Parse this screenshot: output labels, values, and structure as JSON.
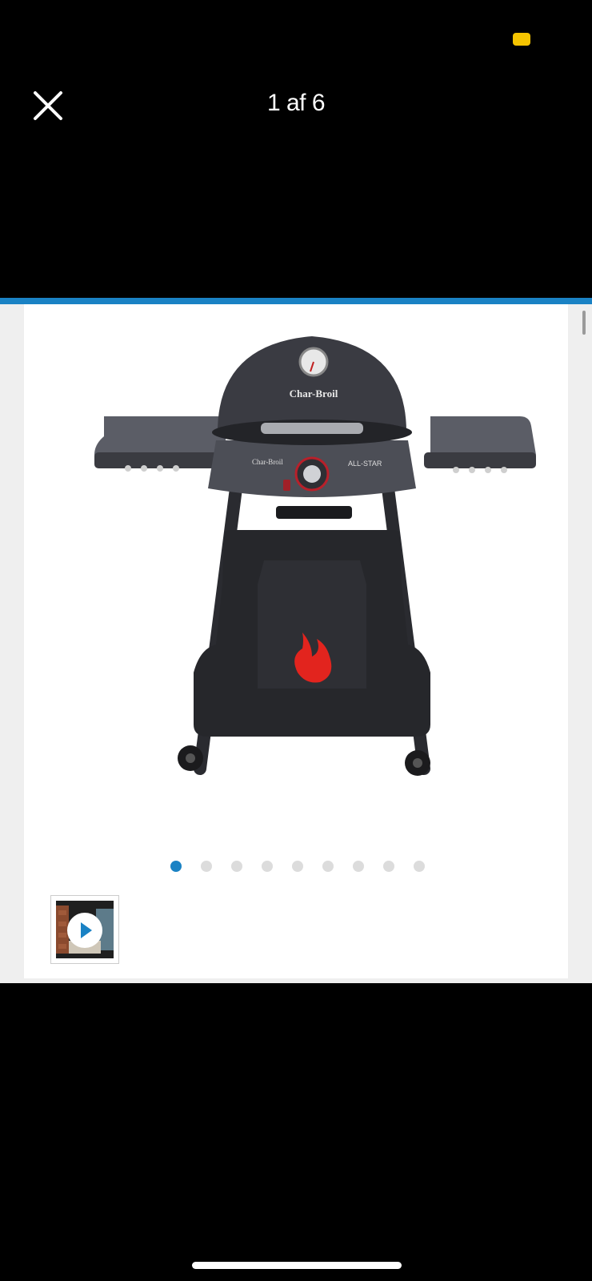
{
  "colors": {
    "background": "#000000",
    "accent": "#1a82c4",
    "status_indicator": "#f5c400",
    "dot_active": "#1a82c4",
    "dot_inactive": "#dcdcdc",
    "flame": "#e2241e"
  },
  "header": {
    "counter_text": "1 af 6",
    "close_icon": "close-icon"
  },
  "gallery": {
    "dots_count": 9,
    "active_index": 0,
    "video_thumbnail_icon": "play-icon"
  },
  "product_image": {
    "brand_lid": "Char-Broil",
    "brand_panel": "Char-Broil",
    "model_badge": "ALL-STAR"
  }
}
